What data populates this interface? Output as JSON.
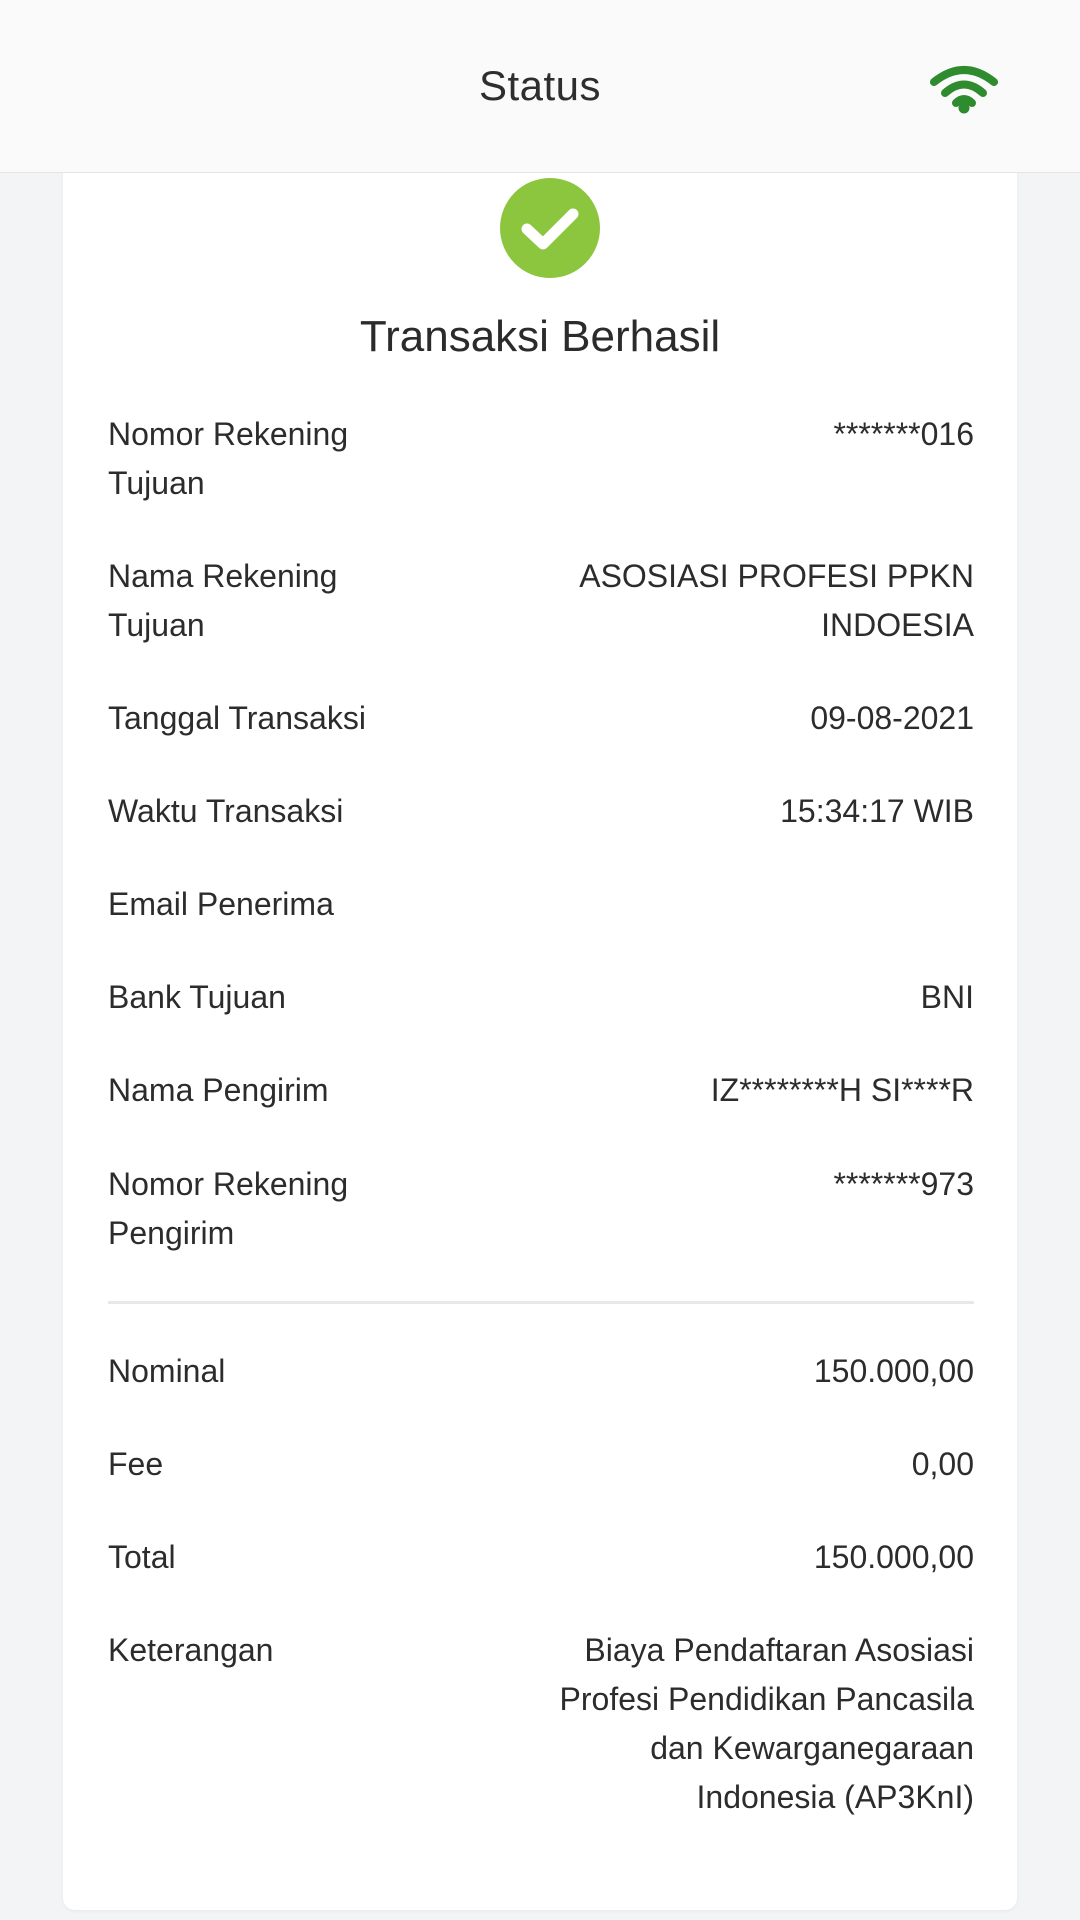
{
  "header": {
    "title": "Status",
    "status_icon": "wifi-icon",
    "status_color": "#2e8b2e"
  },
  "result": {
    "icon": "check-circle-icon",
    "icon_color": "#8cc63f",
    "title": "Transaksi Berhasil"
  },
  "details": [
    {
      "label": "Nomor Rekening Tujuan",
      "value": "*******016"
    },
    {
      "label": "Nama Rekening Tujuan",
      "value": "ASOSIASI PROFESI PPKN INDOESIA"
    },
    {
      "label": "Tanggal Transaksi",
      "value": "09-08-2021"
    },
    {
      "label": "Waktu Transaksi",
      "value": "15:34:17 WIB"
    },
    {
      "label": "Email Penerima",
      "value": ""
    },
    {
      "label": "Bank Tujuan",
      "value": "BNI"
    },
    {
      "label": "Nama Pengirim",
      "value": "IZ********H SI****R"
    },
    {
      "label": "Nomor Rekening Pengirim",
      "value": "*******973"
    }
  ],
  "amounts": [
    {
      "label": "Nominal",
      "value": "150.000,00"
    },
    {
      "label": "Fee",
      "value": "0,00"
    },
    {
      "label": "Total",
      "value": "150.000,00"
    },
    {
      "label": "Keterangan",
      "value": "Biaya Pendaftaran Asosiasi Profesi Pendidikan Pancasila dan Kewarganegaraan Indonesia (AP3KnI)"
    }
  ]
}
